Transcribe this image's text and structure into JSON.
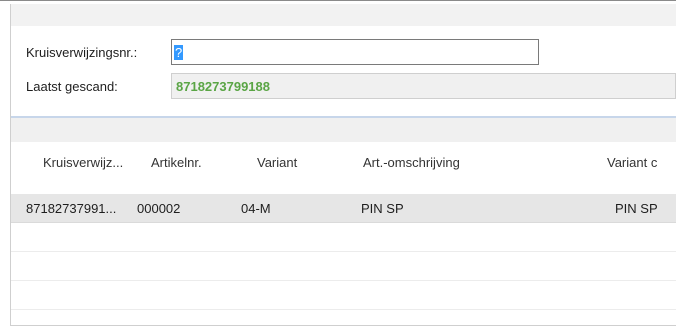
{
  "form": {
    "cross_ref_label": "Kruisverwijzingsnr.:",
    "cross_ref_value": "?",
    "last_scanned_label": "Laatst gescand:",
    "last_scanned_value": "8718273799188"
  },
  "grid": {
    "columns": [
      "Kruisverwijz...",
      "Artikelnr.",
      "Variant",
      "Art.-omschrijving",
      "Variant c"
    ],
    "rows": [
      [
        "87182737991...",
        "000002",
        "04-M",
        "PIN SP",
        "PIN SP"
      ]
    ]
  },
  "colors": {
    "selection": "#3399ff",
    "scanned_value": "#5aa545",
    "selected_row": "#e6e6e6"
  }
}
